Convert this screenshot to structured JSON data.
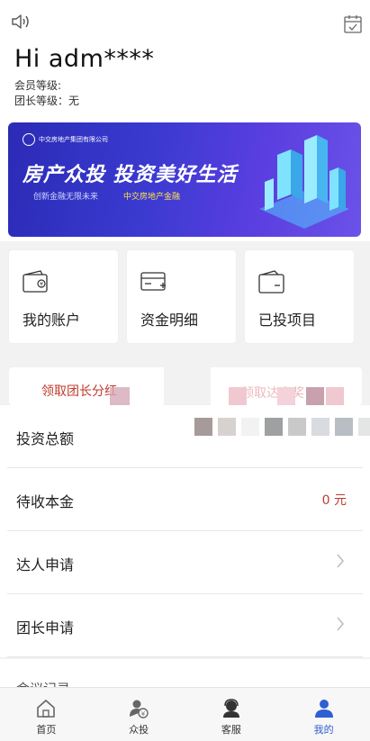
{
  "header": {
    "greeting": "Hi adm****",
    "member_level_label": "会员等级:",
    "leader_level_label": "团长等级：无"
  },
  "banner": {
    "company": "中交房地产集团有限公司",
    "headline": "房产众投  投资美好生活",
    "subline": "创新金融无限未来",
    "tagline": "中交房地产金融"
  },
  "quick_cards": [
    {
      "label": "我的账户",
      "icon": "wallet-icon"
    },
    {
      "label": "资金明细",
      "icon": "card-icon"
    },
    {
      "label": "已投项目",
      "icon": "purse-icon"
    }
  ],
  "promo": {
    "left": "领取团长分红",
    "right": "领取达人奖"
  },
  "list": [
    {
      "label": "投资总额"
    },
    {
      "label": "待收本金",
      "value": "0 元"
    },
    {
      "label": "达人申请",
      "arrow": true
    },
    {
      "label": "团长申请",
      "arrow": true
    }
  ],
  "partial_row": "会议记录",
  "tabs": [
    {
      "label": "首页",
      "icon": "home-icon"
    },
    {
      "label": "众投",
      "icon": "invest-icon"
    },
    {
      "label": "客服",
      "icon": "service-icon"
    },
    {
      "label": "我的",
      "icon": "user-icon",
      "active": true
    }
  ],
  "colors": {
    "accent": "#2f5fd0",
    "red": "#c0392b",
    "banner_start": "#2b2bb6",
    "banner_end": "#6b52e8"
  }
}
